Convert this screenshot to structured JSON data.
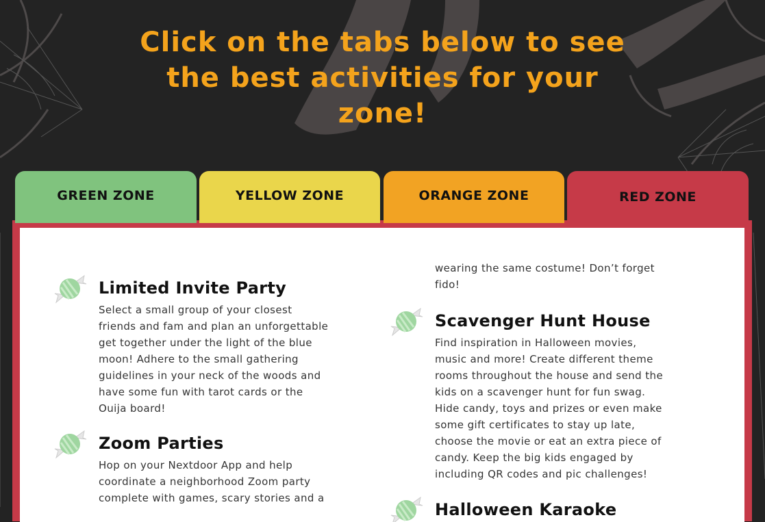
{
  "headline": "Click on the tabs below to see the best activities for your zone!",
  "tabs": [
    {
      "label": "GREEN ZONE",
      "color": "#80c37e"
    },
    {
      "label": "YELLOW ZONE",
      "color": "#ead64b"
    },
    {
      "label": "ORANGE ZONE",
      "color": "#f2a323"
    },
    {
      "label": "RED ZONE",
      "color": "#c63a48"
    }
  ],
  "active_tab": "RED ZONE",
  "theme": {
    "background": "#232323",
    "headline_color": "#f4a31c",
    "candy_color": "#9fd6a0"
  },
  "left_column": [
    {
      "icon": "candy-icon",
      "title": "Limited Invite Party",
      "description": "Select a small group of your closest friends and fam and plan an unforgettable get together under the light of the blue moon! Adhere to the small gathering guidelines in your neck of the woods and have some fun with tarot cards or the Ouija board!"
    },
    {
      "icon": "candy-icon",
      "title": "Zoom Parties",
      "description": "Hop on your Nextdoor App and help coordinate a neighborhood Zoom party complete with games, scary stories and a"
    }
  ],
  "right_column": {
    "continued_text": "wearing the same costume! Don’t forget fido!",
    "items": [
      {
        "icon": "candy-icon",
        "title": "Scavenger Hunt House",
        "description": "Find inspiration in Halloween movies, music and more! Create different theme rooms throughout the house and send the kids on a scavenger hunt for fun swag. Hide candy, toys and prizes or even make some gift certificates to stay up late, choose the movie or eat an extra piece of candy. Keep the big kids engaged by including QR codes and pic challenges!"
      },
      {
        "icon": "candy-icon",
        "title": "Halloween Karaoke",
        "description": ""
      }
    ]
  }
}
